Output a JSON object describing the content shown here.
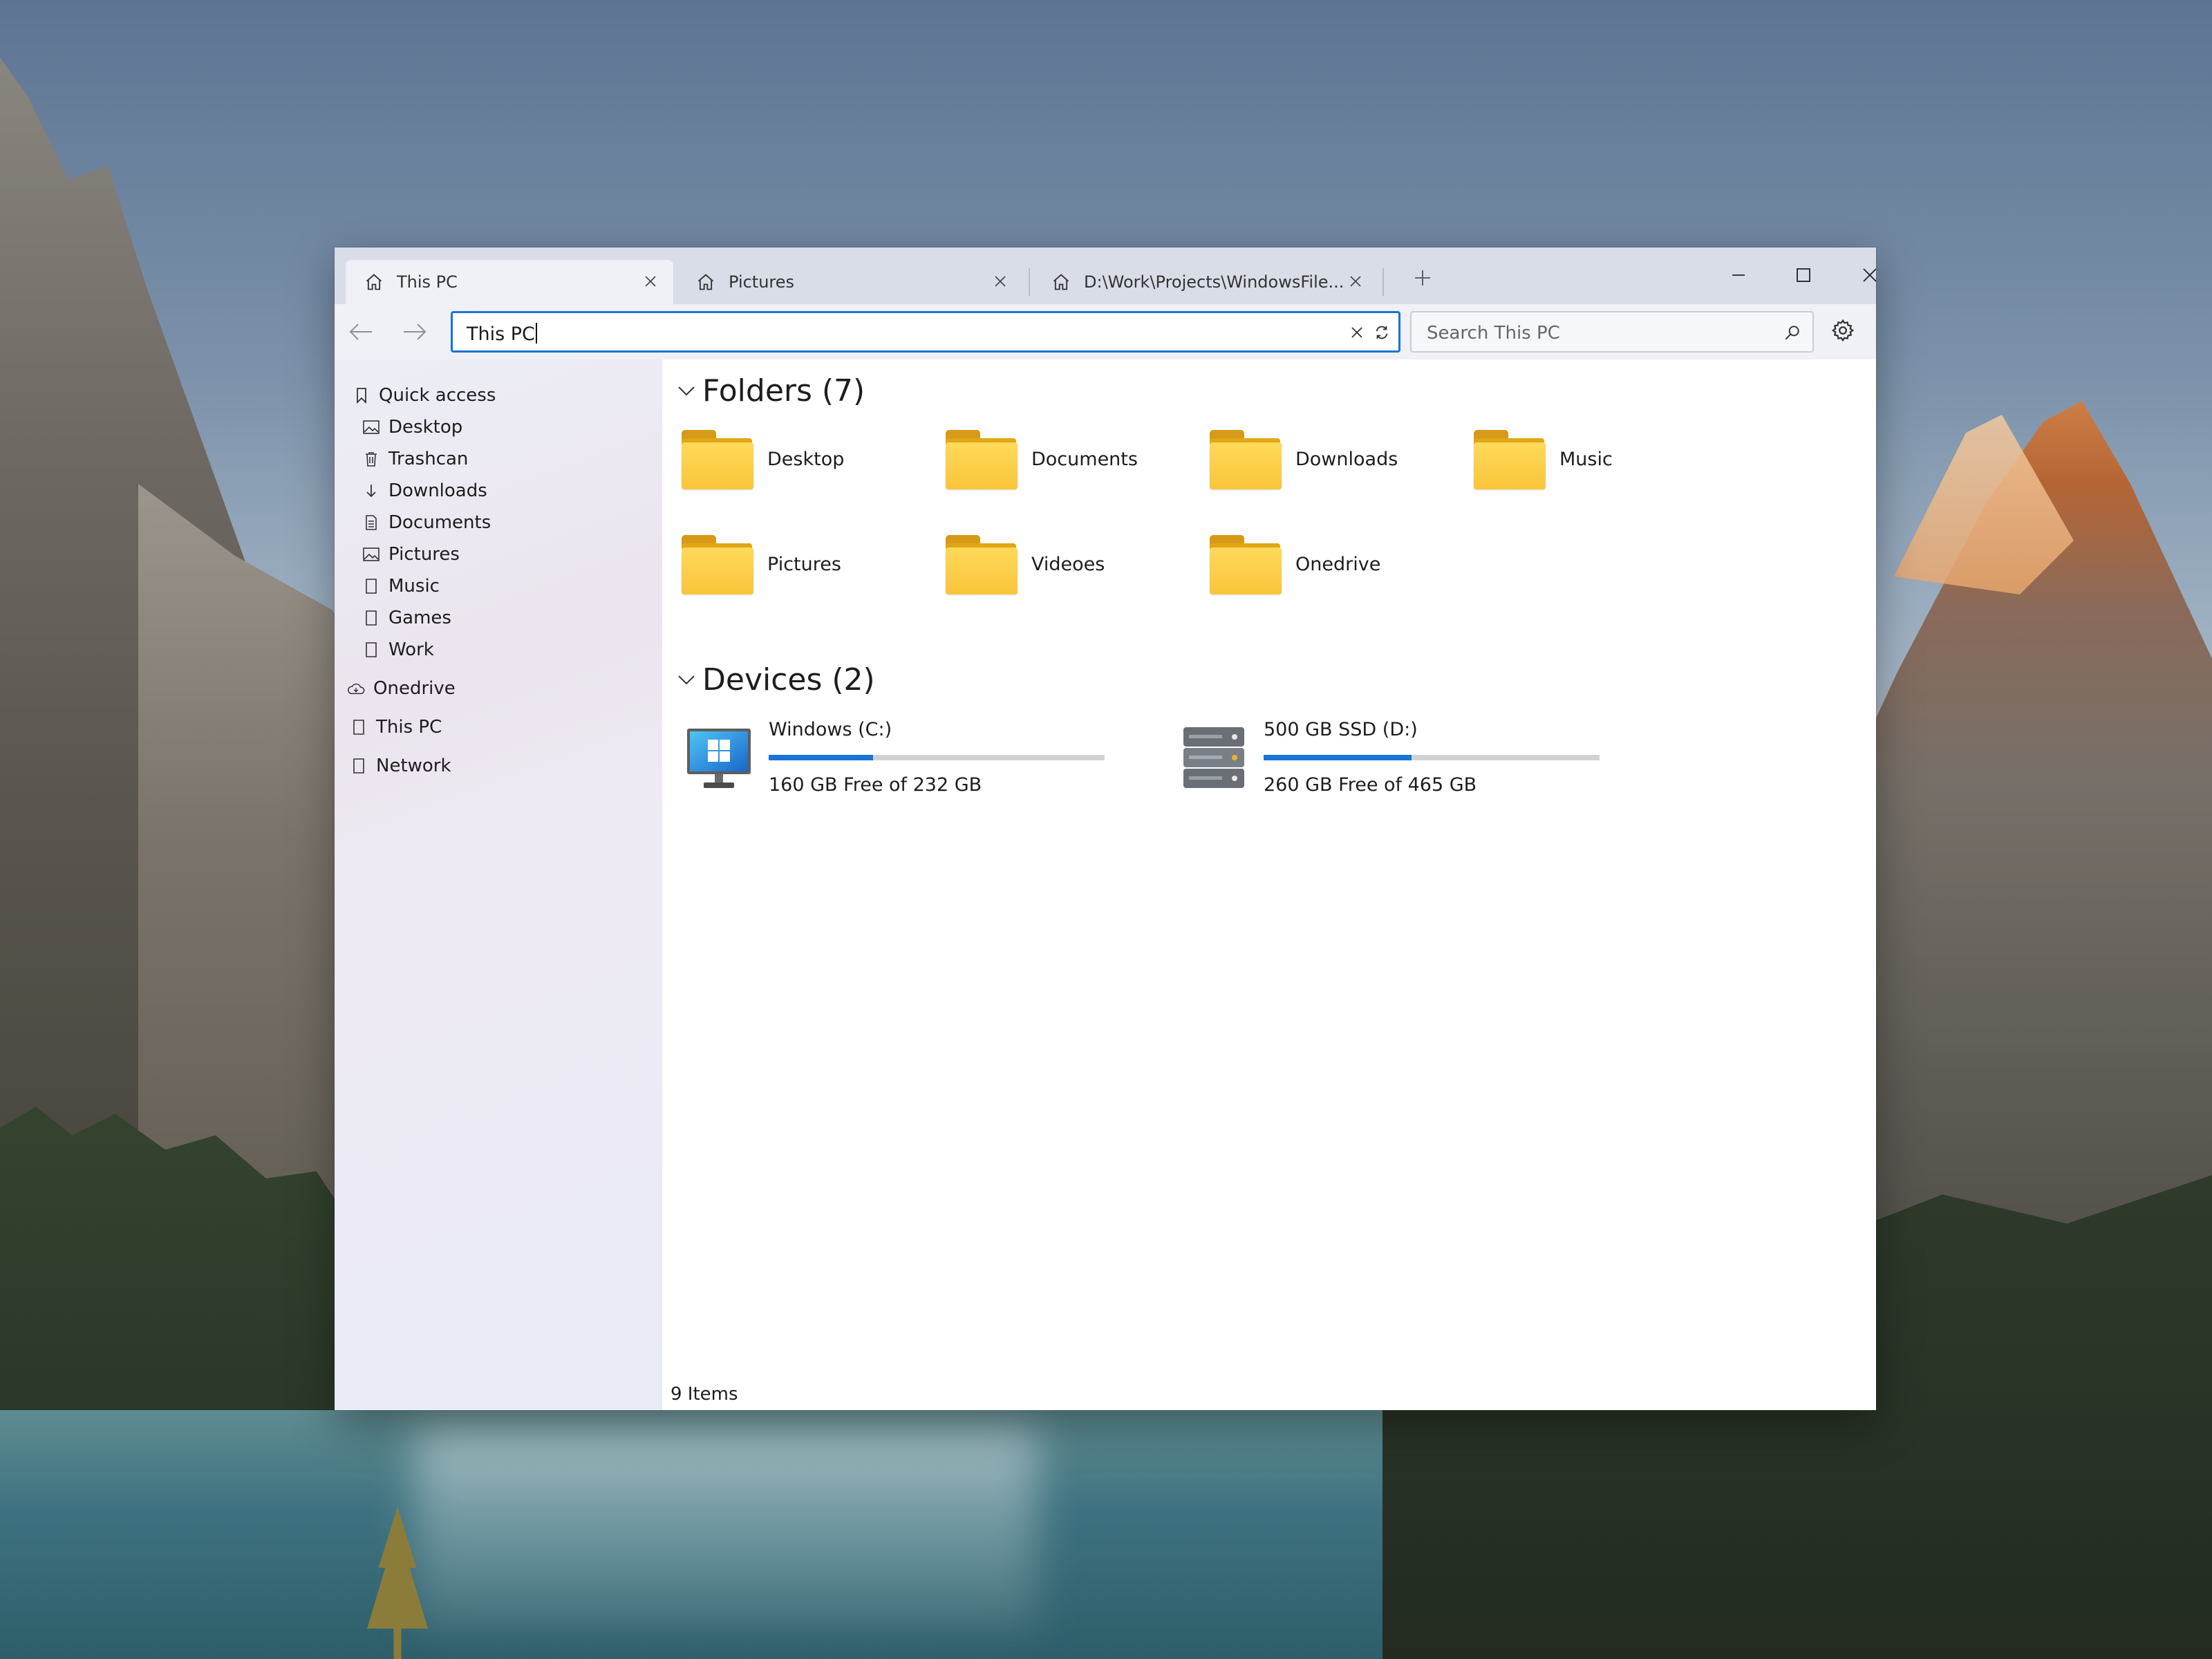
{
  "tabs": [
    {
      "label": "This PC",
      "icon": "home-icon",
      "active": true
    },
    {
      "label": "Pictures",
      "icon": "home-icon",
      "active": false
    },
    {
      "label": "D:\\Work\\Projects\\WindowsFile...",
      "icon": "home-icon",
      "active": false
    }
  ],
  "address": {
    "value": "This PC"
  },
  "search": {
    "placeholder": "Search This PC"
  },
  "sidebar": {
    "quick_access": {
      "label": "Quick access",
      "icon": "bookmark-icon"
    },
    "items": [
      {
        "label": "Desktop",
        "icon": "image-icon"
      },
      {
        "label": "Trashcan",
        "icon": "trash-icon"
      },
      {
        "label": "Downloads",
        "icon": "arrow-down-icon"
      },
      {
        "label": "Documents",
        "icon": "document-icon"
      },
      {
        "label": "Pictures",
        "icon": "image-icon"
      },
      {
        "label": "Music",
        "icon": "page-icon"
      },
      {
        "label": "Games",
        "icon": "page-icon"
      },
      {
        "label": "Work",
        "icon": "page-icon"
      }
    ],
    "roots": [
      {
        "label": "Onedrive",
        "icon": "cloud-icon"
      },
      {
        "label": "This PC",
        "icon": "page-icon"
      },
      {
        "label": "Network",
        "icon": "page-icon"
      }
    ]
  },
  "folders_section": {
    "title": "Folders (7)"
  },
  "folders": [
    {
      "label": "Desktop"
    },
    {
      "label": "Documents"
    },
    {
      "label": "Downloads"
    },
    {
      "label": "Music"
    },
    {
      "label": "Pictures"
    },
    {
      "label": "Videoes"
    },
    {
      "label": "Onedrive"
    }
  ],
  "devices_section": {
    "title": "Devices (2)"
  },
  "devices": [
    {
      "name": "Windows (C:)",
      "free_text": "160 GB Free of 232 GB",
      "used_fraction": 0.31,
      "icon": "monitor-icon"
    },
    {
      "name": "500 GB SSD (D:)",
      "free_text": "260 GB Free of 465 GB",
      "used_fraction": 0.44,
      "icon": "server-drive-icon"
    }
  ],
  "status": {
    "items": "9 Items"
  },
  "colors": {
    "accent": "#1a73d6",
    "folder": "#f9c53a",
    "titlebar": "#d9dde8"
  }
}
